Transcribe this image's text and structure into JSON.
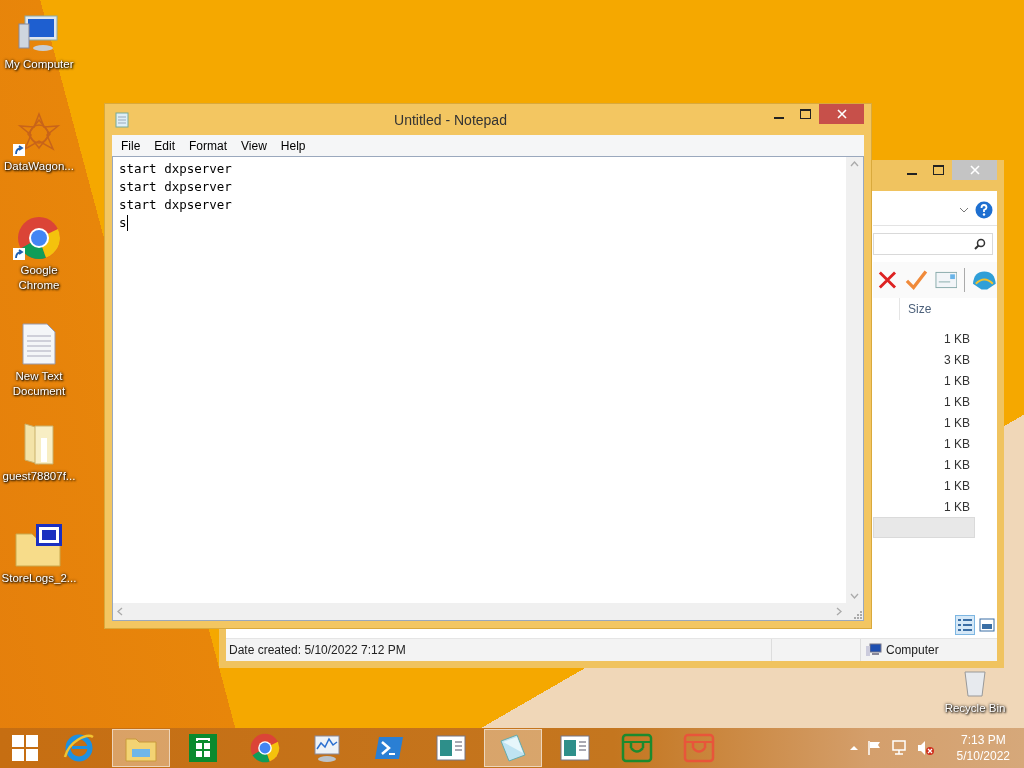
{
  "desktop_icons": [
    {
      "label": "My Computer",
      "kind": "computer",
      "shortcut": false
    },
    {
      "label": "DataWagon...",
      "kind": "star",
      "shortcut": true
    },
    {
      "label": "Google Chrome",
      "kind": "chrome",
      "shortcut": true
    },
    {
      "label": "New Text Document",
      "kind": "textfile",
      "shortcut": false
    },
    {
      "label": "guest78807f...",
      "kind": "folder",
      "shortcut": false
    },
    {
      "label": "StoreLogs_2...",
      "kind": "cafolder",
      "shortcut": false
    }
  ],
  "recycle_bin": {
    "label": "Recycle Bin"
  },
  "notepad": {
    "title": "Untitled - Notepad",
    "menu": [
      "File",
      "Edit",
      "Format",
      "View",
      "Help"
    ],
    "lines": [
      "start dxpserver",
      "start dxpserver",
      "start dxpserver",
      "s"
    ]
  },
  "explorer": {
    "size_header": "Size",
    "rows": [
      {
        "size": "1 KB",
        "selected": false
      },
      {
        "size": "3 KB",
        "selected": false
      },
      {
        "size": "1 KB",
        "selected": false
      },
      {
        "size": "1 KB",
        "selected": false
      },
      {
        "size": "1 KB",
        "selected": false
      },
      {
        "size": "1 KB",
        "selected": false
      },
      {
        "size": "1 KB",
        "selected": false
      },
      {
        "size": "1 KB",
        "selected": false
      },
      {
        "size": "1 KB",
        "selected": false
      },
      {
        "selected": true
      }
    ],
    "views": [
      {
        "kind": "details",
        "selected": true
      },
      {
        "kind": "tiles",
        "selected": false
      }
    ],
    "status_bar": {
      "date_created": "Date created: 5/10/2022 7:12 PM",
      "location": "Computer"
    }
  },
  "taskbar": {
    "items": [
      {
        "kind": "ie",
        "active": false
      },
      {
        "kind": "explorer",
        "active": true
      },
      {
        "kind": "store",
        "active": false
      },
      {
        "kind": "chrome",
        "active": false
      },
      {
        "kind": "monitor",
        "active": false
      },
      {
        "kind": "powershell",
        "active": false
      },
      {
        "kind": "app",
        "active": false
      },
      {
        "kind": "notepad",
        "active": true
      },
      {
        "kind": "app",
        "active": false
      },
      {
        "kind": "green",
        "active": false
      },
      {
        "kind": "red",
        "active": false
      }
    ],
    "time": "7:13 PM",
    "date": "5/10/2022"
  }
}
